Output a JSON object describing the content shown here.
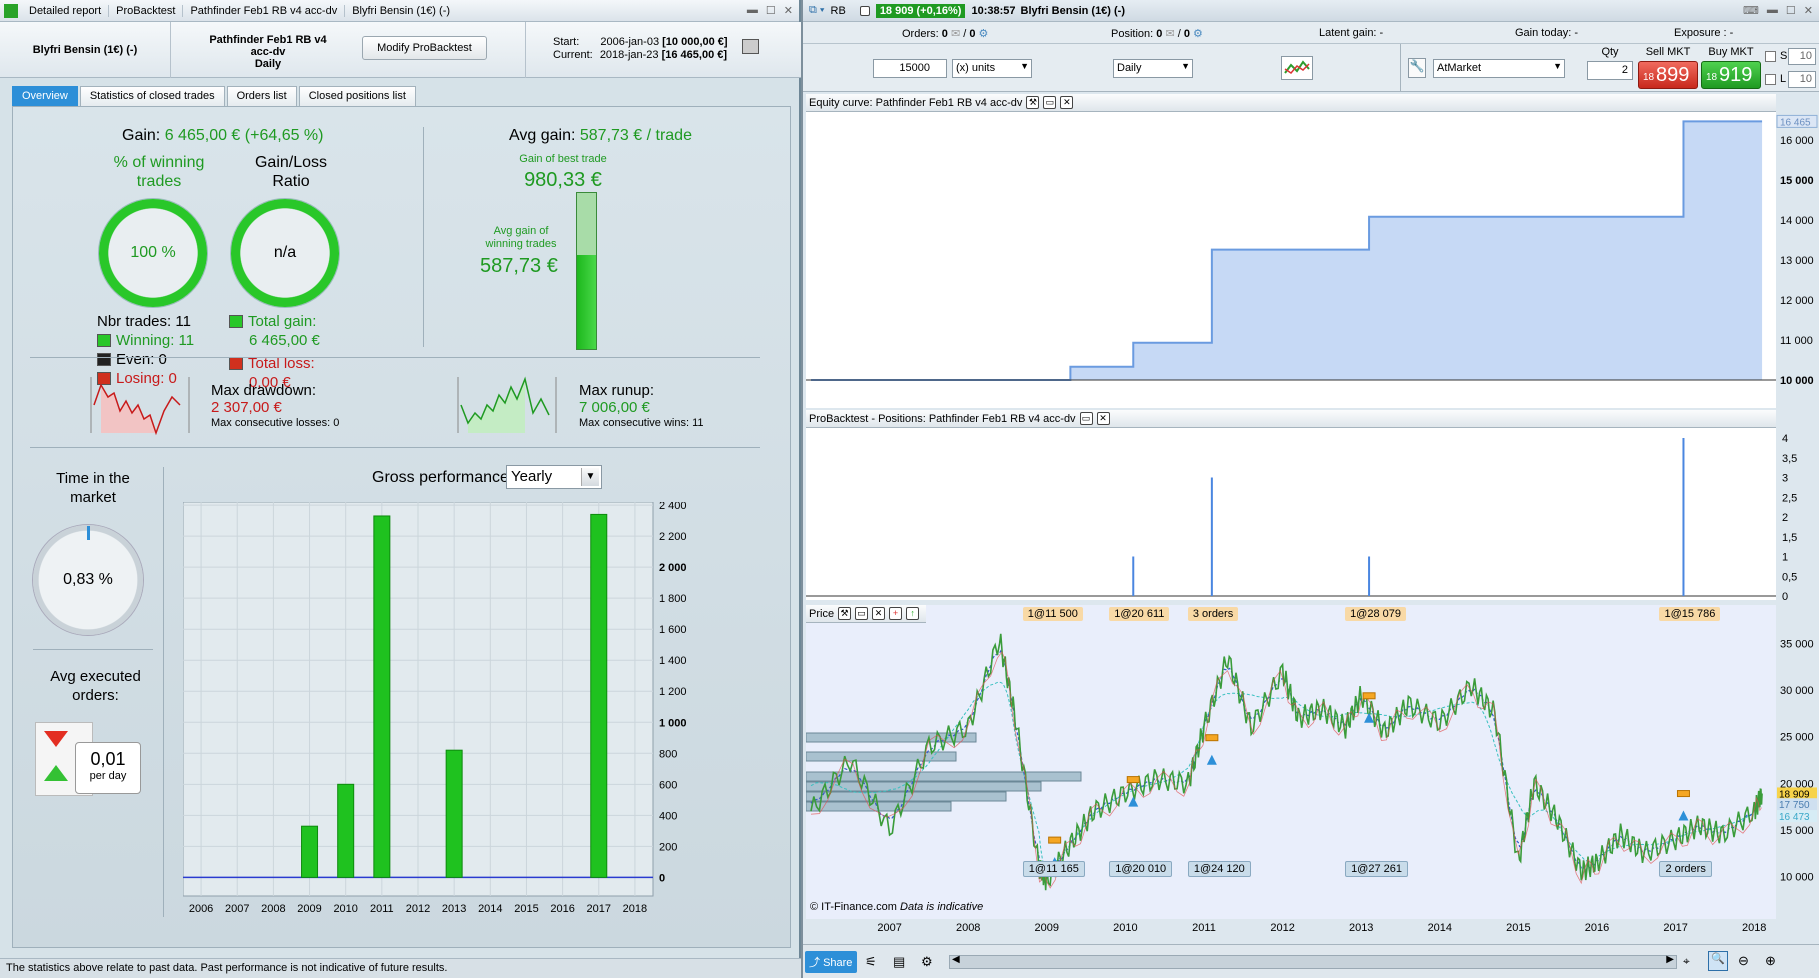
{
  "left_window": {
    "tabs": [
      "Detailed report",
      "ProBacktest",
      "Pathfinder Feb1 RB v4 acc-dv",
      "Blyfri Bensin (1€) (-)"
    ],
    "header": {
      "instrument": "Blyfri Bensin (1€) (-)",
      "system": "Pathfinder Feb1 RB v4 acc-dv",
      "period": "Daily",
      "modify_button": "Modify ProBacktest",
      "start_label": "Start:",
      "start_value": "2006-jan-03",
      "start_capital": "[10 000,00 €]",
      "current_label": "Current:",
      "current_value": "2018-jan-23",
      "current_capital": "[16 465,00 €]"
    },
    "subtabs": [
      "Overview",
      "Statistics of closed trades",
      "Orders list",
      "Closed positions list"
    ],
    "overview": {
      "gain_label": "Gain:",
      "gain_value": "6 465,00 € (+64,65 %)",
      "pct_winning_label": "% of winning trades",
      "pct_winning_value": "100 %",
      "gl_ratio_label": "Gain/Loss Ratio",
      "gl_ratio_value": "n/a",
      "nbr_trades": "Nbr trades: 11",
      "winning": "Winning: 11",
      "even": "Even: 0",
      "losing": "Losing: 0",
      "total_gain_label": "Total gain:",
      "total_gain_value": "6 465,00 €",
      "total_loss_label": "Total loss:",
      "total_loss_value": "0,00 €",
      "avg_gain_label": "Avg gain:",
      "avg_gain_value": "587,73 € / trade",
      "best_trade_label": "Gain of best trade",
      "best_trade_value": "980,33 €",
      "avg_win_label": "Avg gain of winning trades",
      "avg_win_value": "587,73 €",
      "avg_win_fraction": 0.6,
      "max_drawdown_label": "Max drawdown:",
      "max_drawdown_value": "2 307,00 €",
      "max_cons_losses": "Max consecutive losses: 0",
      "max_runup_label": "Max runup:",
      "max_runup_value": "7 006,00 €",
      "max_cons_wins": "Max consecutive wins: 11",
      "time_market_label": "Time in the market",
      "time_market_value": "0,83 %",
      "avg_orders_label": "Avg executed orders:",
      "avg_orders_value": "0,01",
      "avg_orders_unit": "per day",
      "gross_perf_label": "Gross performance",
      "gross_perf_select": "Yearly"
    },
    "status": "The statistics above relate to past data. Past performance is not indicative of future results."
  },
  "chart_data": [
    {
      "type": "bar",
      "title": "Gross performance",
      "categories": [
        "2006",
        "2007",
        "2008",
        "2009",
        "2010",
        "2011",
        "2012",
        "2013",
        "2014",
        "2015",
        "2016",
        "2017",
        "2018"
      ],
      "values": [
        0,
        0,
        0,
        330,
        600,
        2330,
        0,
        820,
        0,
        0,
        0,
        2340,
        0
      ],
      "ylim": [
        -120,
        2420
      ],
      "yticks": [
        "2 400",
        "2 200",
        "2 000",
        "1 800",
        "1 600",
        "1 400",
        "1 200",
        "1 000",
        "800",
        "600",
        "400",
        "200",
        "0"
      ],
      "bold_ticks": [
        "2 000",
        "1 000",
        "0"
      ],
      "color": "#1fc21f"
    },
    {
      "type": "area",
      "title": "Equity curve: Pathfinder Feb1 RB v4 acc-dv",
      "x": [
        2006.0,
        2009.3,
        2009.3,
        2010.1,
        2010.1,
        2011.1,
        2011.1,
        2013.1,
        2013.1,
        2017.1,
        2017.1,
        2018.1
      ],
      "values": [
        10000,
        10000,
        10330,
        10330,
        10930,
        10930,
        13260,
        13260,
        14080,
        14080,
        16465,
        16465
      ],
      "ylim": [
        9300,
        16700
      ],
      "yticks": [
        "16 000",
        "15 000",
        "14 000",
        "13 000",
        "12 000",
        "11 000",
        "10 000"
      ],
      "last_label": "16 465"
    },
    {
      "type": "bar",
      "title": "ProBacktest - Positions: Pathfinder Feb1 RB v4 acc-dv",
      "x": [
        2010.1,
        2011.1,
        2013.1,
        2017.1
      ],
      "values": [
        1,
        3,
        1,
        4
      ],
      "yticks": [
        "4",
        "3,5",
        "3",
        "2,5",
        "2",
        "1,5",
        "1",
        "0,5",
        "0"
      ]
    },
    {
      "type": "line",
      "title": "Price",
      "x_ticks": [
        "2007",
        "2008",
        "2009",
        "2010",
        "2011",
        "2012",
        "2013",
        "2014",
        "2015",
        "2016",
        "2017",
        "2018"
      ],
      "yticks": [
        "35 000",
        "30 000",
        "25 000",
        "20 000",
        "15 000",
        "10 000"
      ],
      "price_labels": [
        "18 909",
        "17 750",
        "16 473"
      ],
      "ylim": [
        8000,
        37000
      ],
      "series": [
        {
          "x": [
            2006.0,
            2006.5,
            2007.0,
            2007.5,
            2008.0,
            2008.4,
            2008.6,
            2008.9,
            2009.0,
            2009.3,
            2009.6,
            2010.0,
            2010.4,
            2010.8,
            2011.0,
            2011.3,
            2011.6,
            2012.0,
            2012.2,
            2012.5,
            2012.8,
            2013.0,
            2013.3,
            2013.6,
            2014.0,
            2014.4,
            2014.7,
            2015.0,
            2015.2,
            2015.5,
            2015.8,
            2016.0,
            2016.3,
            2016.6,
            2017.0,
            2017.3,
            2017.6,
            2018.0,
            2018.1
          ],
          "y": [
            17000,
            22500,
            15000,
            24000,
            26000,
            35500,
            27000,
            11000,
            9500,
            13500,
            17000,
            19000,
            20500,
            20000,
            26000,
            33500,
            26000,
            32000,
            27000,
            28000,
            26000,
            29500,
            25500,
            28500,
            26500,
            30500,
            27500,
            11500,
            20000,
            16000,
            10500,
            11500,
            14500,
            12500,
            14000,
            15500,
            14500,
            17000,
            18900
          ]
        }
      ],
      "order_tags_top": [
        "1@11 500",
        "1@20 611",
        "3 orders",
        "1@28 079",
        "1@15 786"
      ],
      "order_tags_bottom": [
        "1@11 165",
        "1@20 010",
        "1@24 120",
        "1@27 261",
        "2 orders"
      ],
      "footer": "© IT-Finance.com",
      "footer_note": "Data is indicative"
    }
  ],
  "right_window": {
    "ticker": "RB",
    "price_badge": "18 909 (+0,16%)",
    "time": "10:38:57",
    "instrument": "Blyfri Bensin (1€) (-)",
    "orders_label": "Orders:",
    "orders_value": "0",
    "orders_value2": "0",
    "position_label": "Position:",
    "position_value": "0",
    "position_value2": "0",
    "latent_label": "Latent gain: -",
    "gain_today_label": "Gain today: -",
    "exposure_label": "Exposure : -",
    "qty_units": "15000",
    "units_select": "(x) units",
    "period_select": "Daily",
    "order_type": "AtMarket",
    "qty_label": "Qty",
    "qty_value": "2",
    "sell_label": "Sell MKT",
    "sell_small": "18",
    "sell_big": "899",
    "buy_label": "Buy MKT",
    "buy_small": "18",
    "buy_big": "919",
    "s_label": "S",
    "s_value": "10",
    "l_label": "L",
    "l_value": "10",
    "share_label": "Share"
  },
  "colors": {
    "green": "#1f9a22",
    "red": "#c71a1a",
    "accent": "#2d8fd8",
    "equity_fill": "#c6d9f5",
    "equity_line": "#6a9be0"
  }
}
